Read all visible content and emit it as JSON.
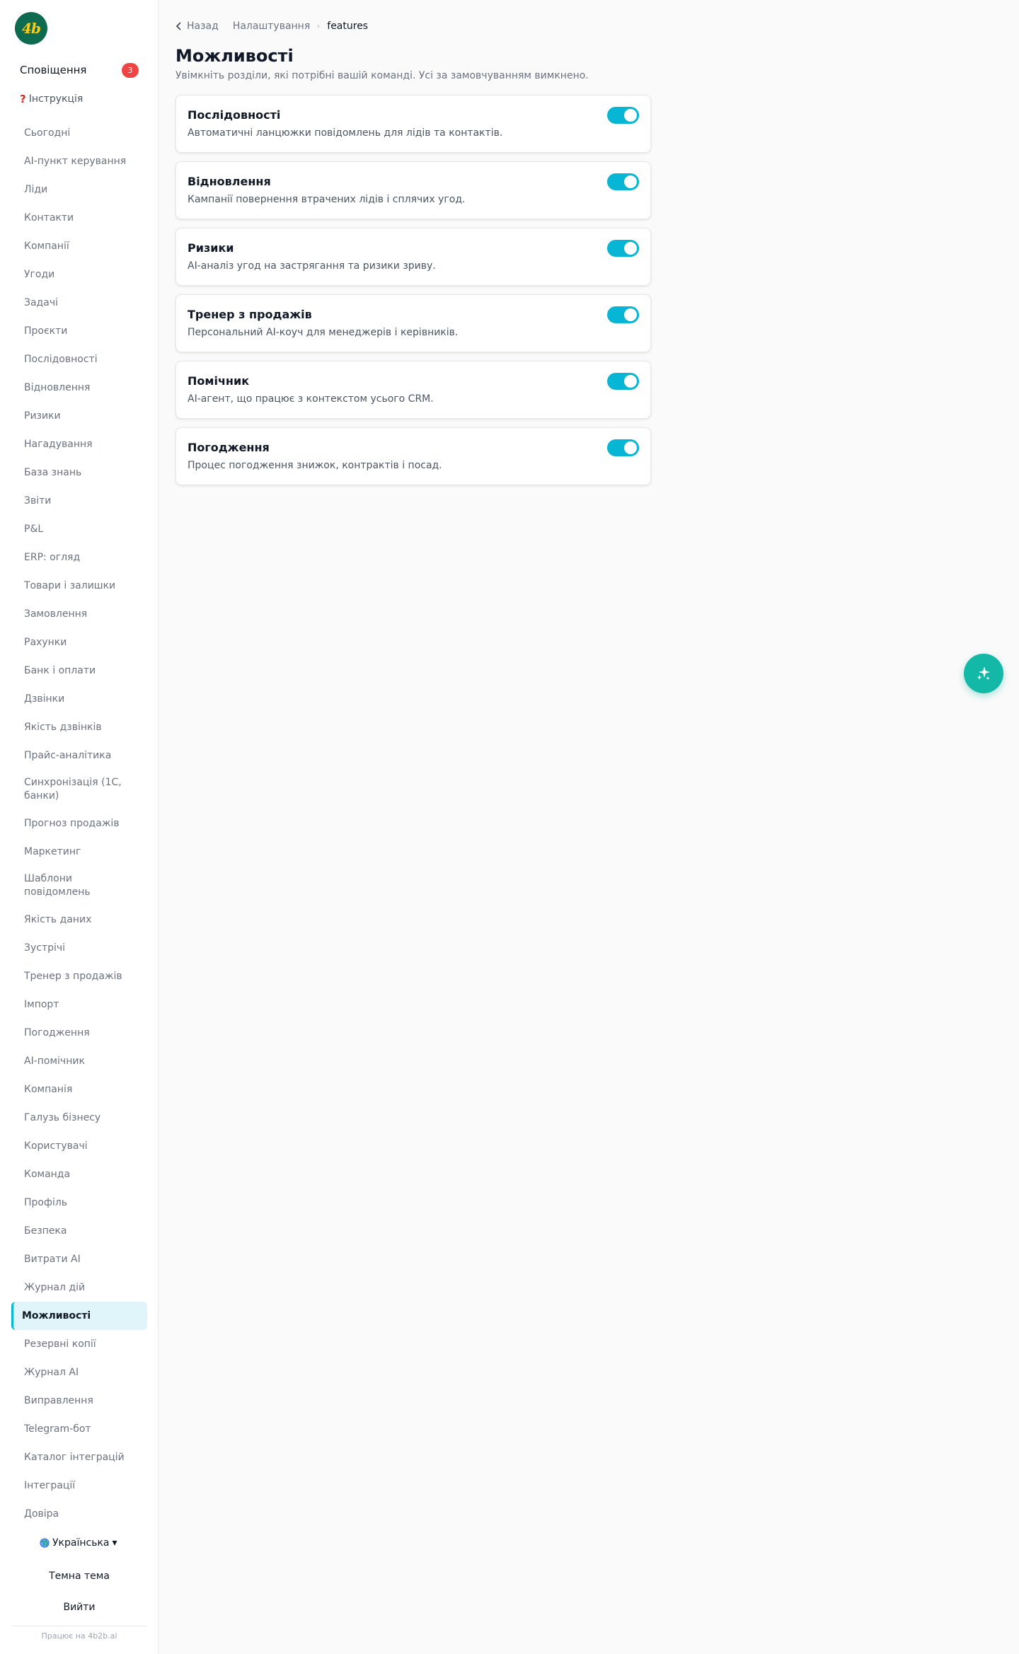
{
  "logo": {
    "text": "4b"
  },
  "sidebar": {
    "notifications": {
      "label": "Сповіщення",
      "count": "3"
    },
    "help": {
      "icon": "question-icon",
      "glyph": "?",
      "label": "Інструкція"
    },
    "items": [
      {
        "label": "Сьогодні"
      },
      {
        "label": "AI-пункт керування"
      },
      {
        "label": "Ліди"
      },
      {
        "label": "Контакти"
      },
      {
        "label": "Компанії"
      },
      {
        "label": "Угоди"
      },
      {
        "label": "Задачі"
      },
      {
        "label": "Проєкти"
      },
      {
        "label": "Послідовності"
      },
      {
        "label": "Відновлення"
      },
      {
        "label": "Ризики"
      },
      {
        "label": "Нагадування"
      },
      {
        "label": "База знань"
      },
      {
        "label": "Звіти"
      },
      {
        "label": "P&L"
      },
      {
        "label": "ERP: огляд"
      },
      {
        "label": "Товари і залишки"
      },
      {
        "label": "Замовлення"
      },
      {
        "label": "Рахунки"
      },
      {
        "label": "Банк і оплати"
      },
      {
        "label": "Дзвінки"
      },
      {
        "label": "Якість дзвінків"
      },
      {
        "label": "Прайс-аналітика"
      },
      {
        "label": "Синхронізація (1С, банки)"
      },
      {
        "label": "Прогноз продажів"
      },
      {
        "label": "Маркетинг"
      },
      {
        "label": "Шаблони повідомлень"
      },
      {
        "label": "Якість даних"
      },
      {
        "label": "Зустрічі"
      },
      {
        "label": "Тренер з продажів"
      },
      {
        "label": "Імпорт"
      },
      {
        "label": "Погодження"
      },
      {
        "label": "AI-помічник"
      },
      {
        "label": "Компанія"
      },
      {
        "label": "Галузь бізнесу"
      },
      {
        "label": "Користувачі"
      },
      {
        "label": "Команда"
      },
      {
        "label": "Профіль"
      },
      {
        "label": "Безпека"
      },
      {
        "label": "Витрати AI"
      },
      {
        "label": "Журнал дій"
      },
      {
        "label": "Можливості",
        "active": true
      },
      {
        "label": "Резервні копії"
      },
      {
        "label": "Журнал AI"
      },
      {
        "label": "Виправлення"
      },
      {
        "label": "Telegram-бот"
      },
      {
        "label": "Каталог інтеграцій"
      },
      {
        "label": "Інтеграції"
      },
      {
        "label": "Довіра"
      }
    ],
    "language": {
      "icon": "globe-icon",
      "label": "Українська",
      "caret": "▾"
    },
    "theme_label": "Темна тема",
    "logout_label": "Вийти",
    "powered_by": "Працює на 4b2b.ai"
  },
  "breadcrumb": {
    "back_label": "Назад",
    "settings_label": "Налаштування",
    "current": "features"
  },
  "page": {
    "title": "Можливості",
    "subtitle": "Увімкніть розділи, які потрібні вашій команді. Усі за замовчуванням вимкнено."
  },
  "features": [
    {
      "title": "Послідовності",
      "description": "Автоматичні ланцюжки повідомлень для лідів та контактів.",
      "enabled": true
    },
    {
      "title": "Відновлення",
      "description": "Кампанії повернення втрачених лідів і сплячих угод.",
      "enabled": true
    },
    {
      "title": "Ризики",
      "description": "AI-аналіз угод на застрягання та ризики зриву.",
      "enabled": true
    },
    {
      "title": "Тренер з продажів",
      "description": "Персональний AI-коуч для менеджерів і керівників.",
      "enabled": true
    },
    {
      "title": "Помічник",
      "description": "AI-агент, що працює з контекстом усього CRM.",
      "enabled": true
    },
    {
      "title": "Погодження",
      "description": "Процес погодження знижок, контрактів і посад.",
      "enabled": true
    }
  ],
  "fab": {
    "icon": "sparkles-icon"
  },
  "colors": {
    "accent": "#06b6d4",
    "active_nav_bg": "#e0f5fa",
    "badge": "#ef4444",
    "fab": "#14b8a6",
    "logo_bg": "#0f6b4f",
    "logo_text": "#facc15"
  }
}
